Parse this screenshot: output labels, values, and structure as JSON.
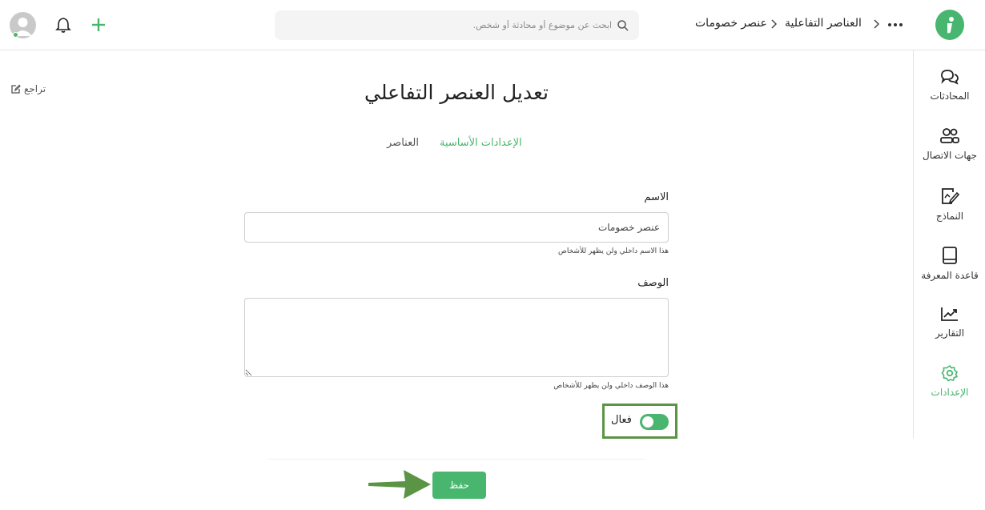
{
  "colors": {
    "accent": "#48b66e",
    "highlight_border": "#5c9446",
    "arrow": "#5c9446"
  },
  "header": {
    "breadcrumb": [
      "العناصر التفاعلية",
      "عنصر خصومات"
    ],
    "search_placeholder": "ابحث عن موضوع أو محادثة أو شخص.",
    "icons": [
      "logo-icon",
      "more-icon",
      "chevron-icon",
      "search-icon",
      "plus-icon",
      "bell-icon",
      "avatar-icon"
    ]
  },
  "sidebar": {
    "items": [
      {
        "label": "المحادثات",
        "icon": "chat-icon",
        "active": false
      },
      {
        "label": "جهات الاتصال",
        "icon": "contacts-icon",
        "active": false
      },
      {
        "label": "النماذج",
        "icon": "forms-icon",
        "active": false
      },
      {
        "label": "قاعدة المعرفة",
        "icon": "book-icon",
        "active": false
      },
      {
        "label": "التقارير",
        "icon": "reports-icon",
        "active": false
      },
      {
        "label": "الإعدادات",
        "icon": "gear-icon",
        "active": true
      }
    ]
  },
  "page": {
    "back_label": "تراجع",
    "title": "تعديل العنصر التفاعلي",
    "tabs": [
      {
        "label": "الإعدادات الأساسية",
        "active": true
      },
      {
        "label": "العناصر",
        "active": false
      }
    ]
  },
  "form": {
    "name": {
      "label": "الاسم",
      "value": "عنصر خصومات",
      "hint": "هذا الاسم داخلي ولن يظهر للأشخاص"
    },
    "description": {
      "label": "الوصف",
      "value": "",
      "hint": "هذا الوصف داخلي ولن يظهر للأشخاص"
    },
    "active_toggle": {
      "label": "فعال",
      "on": true
    },
    "save_label": "حفظ"
  }
}
